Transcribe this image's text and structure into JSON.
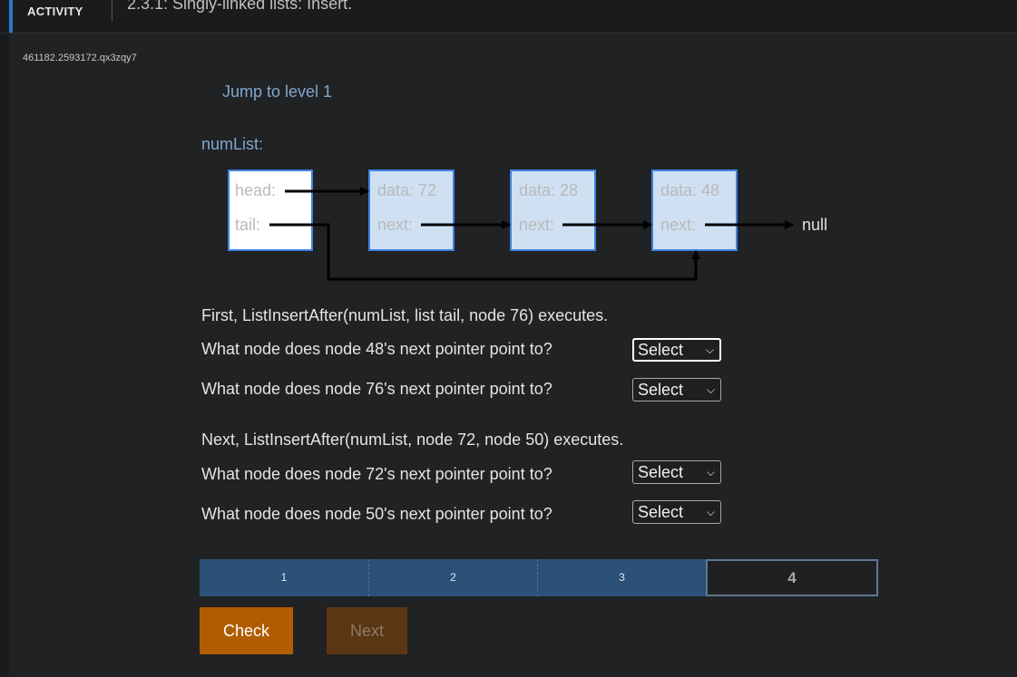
{
  "header": {
    "activity_label": "ACTIVITY",
    "title": "2.3.1: Singly-linked lists: Insert."
  },
  "activity_id": "461182.2593172.qx3zqy7",
  "jump_label": "Jump to level 1",
  "diagram": {
    "list_name": "numList:",
    "head_label": "head:",
    "tail_label": "tail:",
    "nodes": [
      {
        "data_label": "data: 72",
        "next_label": "next:"
      },
      {
        "data_label": "data: 28",
        "next_label": "next:"
      },
      {
        "data_label": "data: 48",
        "next_label": "next:"
      }
    ],
    "null_label": "null"
  },
  "section1": {
    "statement": "First, ListInsertAfter(numList, list tail, node 76) executes.",
    "questions": [
      {
        "text": "What node does node 48's next pointer point to?",
        "select": "Select"
      },
      {
        "text": "What node does node 76's next pointer point to?",
        "select": "Select"
      }
    ]
  },
  "section2": {
    "statement": "Next, ListInsertAfter(numList, node 72, node 50) executes.",
    "questions": [
      {
        "text": "What node does node 72's next pointer point to?",
        "select": "Select"
      },
      {
        "text": "What node does node 50's next pointer point to?",
        "select": "Select"
      }
    ]
  },
  "levels": [
    "1",
    "2",
    "3",
    "4"
  ],
  "current_level": "4",
  "buttons": {
    "check": "Check",
    "next": "Next"
  },
  "colors": {
    "accent": "#2a79c4",
    "level_done": "#2b5178",
    "check": "#b05c00",
    "next_disabled": "#5a3615",
    "node_fill": "#cfe0f3",
    "node_border": "#3f82e0"
  }
}
